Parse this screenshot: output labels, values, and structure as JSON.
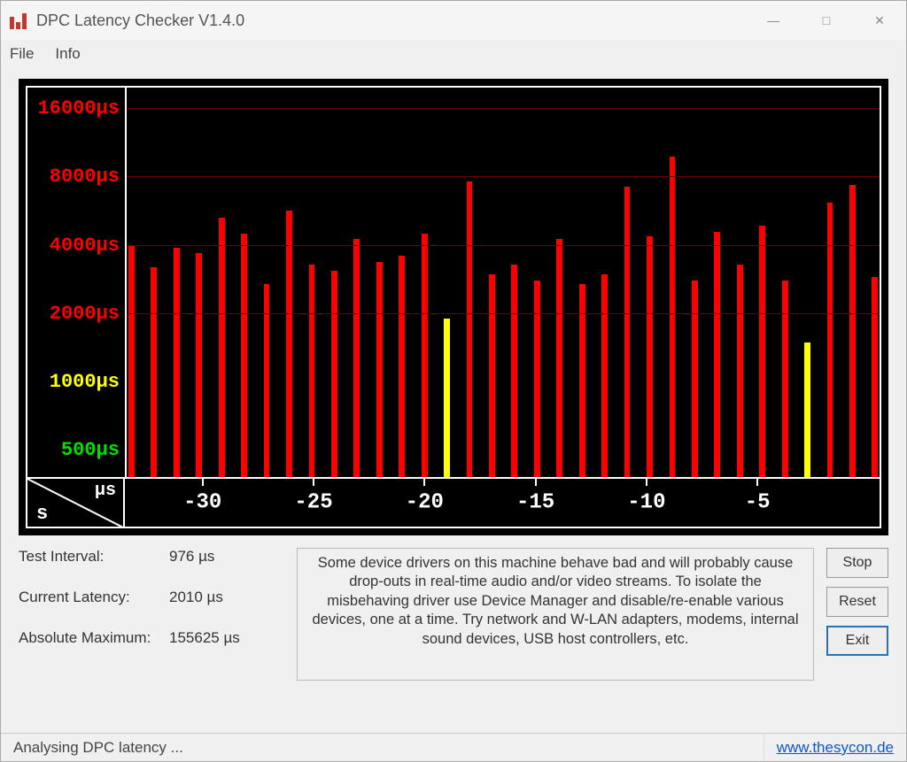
{
  "window": {
    "title": "DPC Latency Checker V1.4.0",
    "menu": {
      "file": "File",
      "info": "Info"
    }
  },
  "chart_data": {
    "type": "bar",
    "xlabel": "s",
    "ylabel": "µs",
    "y_ticks": [
      {
        "label": "16000µs",
        "value": 16000,
        "color": "#ff0000"
      },
      {
        "label": "8000µs",
        "value": 8000,
        "color": "#ff0000"
      },
      {
        "label": "4000µs",
        "value": 4000,
        "color": "#ff0000"
      },
      {
        "label": "2000µs",
        "value": 2000,
        "color": "#ff0000"
      },
      {
        "label": "1000µs",
        "value": 1000,
        "color": "#ffff00"
      },
      {
        "label": "500µs",
        "value": 500,
        "color": "#00e000"
      }
    ],
    "x_ticks": [
      "-30",
      "-25",
      "-20",
      "-15",
      "-10",
      "-5"
    ],
    "gridlines_at": [
      16000,
      8000,
      4000,
      2000
    ],
    "bars": [
      {
        "value": 4000,
        "color": "red"
      },
      {
        "value": 3200,
        "color": "red"
      },
      {
        "value": 3900,
        "color": "red"
      },
      {
        "value": 3700,
        "color": "red"
      },
      {
        "value": 5300,
        "color": "red"
      },
      {
        "value": 4500,
        "color": "red"
      },
      {
        "value": 2700,
        "color": "red"
      },
      {
        "value": 5700,
        "color": "red"
      },
      {
        "value": 3300,
        "color": "red"
      },
      {
        "value": 3100,
        "color": "red"
      },
      {
        "value": 4300,
        "color": "red"
      },
      {
        "value": 3400,
        "color": "red"
      },
      {
        "value": 3600,
        "color": "red"
      },
      {
        "value": 4500,
        "color": "red"
      },
      {
        "value": 1900,
        "color": "yellow"
      },
      {
        "value": 7700,
        "color": "red"
      },
      {
        "value": 3000,
        "color": "red"
      },
      {
        "value": 3300,
        "color": "red"
      },
      {
        "value": 2800,
        "color": "red"
      },
      {
        "value": 4300,
        "color": "red"
      },
      {
        "value": 2700,
        "color": "red"
      },
      {
        "value": 3000,
        "color": "red"
      },
      {
        "value": 7300,
        "color": "red"
      },
      {
        "value": 4400,
        "color": "red"
      },
      {
        "value": 9900,
        "color": "red"
      },
      {
        "value": 2800,
        "color": "red"
      },
      {
        "value": 4600,
        "color": "red"
      },
      {
        "value": 3300,
        "color": "red"
      },
      {
        "value": 4900,
        "color": "red"
      },
      {
        "value": 2800,
        "color": "red"
      },
      {
        "value": 1500,
        "color": "yellow"
      },
      {
        "value": 6200,
        "color": "red"
      },
      {
        "value": 7400,
        "color": "red"
      },
      {
        "value": 2900,
        "color": "red"
      }
    ]
  },
  "stats": {
    "interval_label": "Test Interval:",
    "interval_value": "976 µs",
    "current_label": "Current Latency:",
    "current_value": "2010 µs",
    "absmax_label": "Absolute Maximum:",
    "absmax_value": "155625 µs"
  },
  "message": "Some device drivers on this machine behave bad and will probably cause drop-outs in real-time audio and/or video streams. To isolate the misbehaving driver use Device Manager and disable/re-enable various devices, one at a time. Try network and W-LAN adapters, modems, internal sound devices, USB host controllers, etc.",
  "buttons": {
    "stop": "Stop",
    "reset": "Reset",
    "exit": "Exit"
  },
  "status": {
    "text": "Analysing DPC latency ...",
    "link": "www.thesycon.de"
  }
}
